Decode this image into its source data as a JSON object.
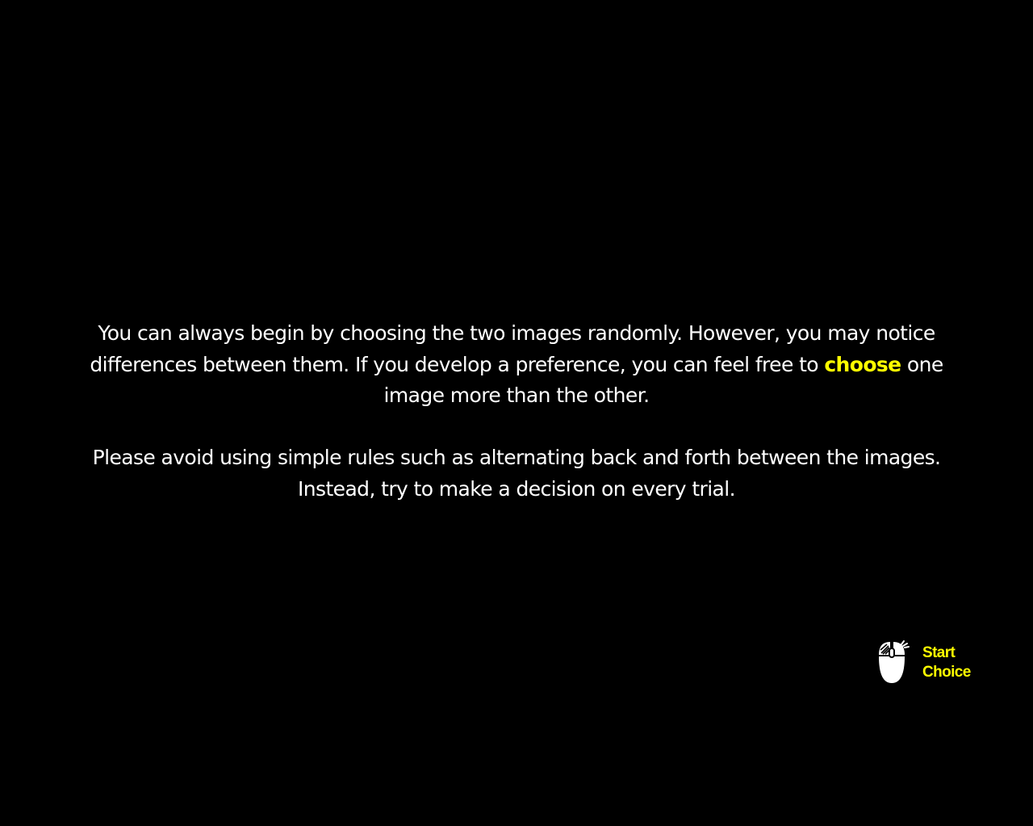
{
  "instructions": {
    "paragraph1": {
      "before": "You can always begin by choosing the two images randomly.  However, you may notice differences between them.  If you develop a preference, you can feel free to ",
      "highlight": "choose",
      "after": " one image more than the other."
    },
    "paragraph2": "Please avoid using simple rules such as alternating back and forth between the images.  Instead, try to make a decision on every trial."
  },
  "start_control": {
    "icon": "mouse-click-icon",
    "label_line1": "Start",
    "label_line2": "Choice"
  },
  "colors": {
    "background": "#000000",
    "text": "#ffffff",
    "accent": "#ffff00"
  }
}
